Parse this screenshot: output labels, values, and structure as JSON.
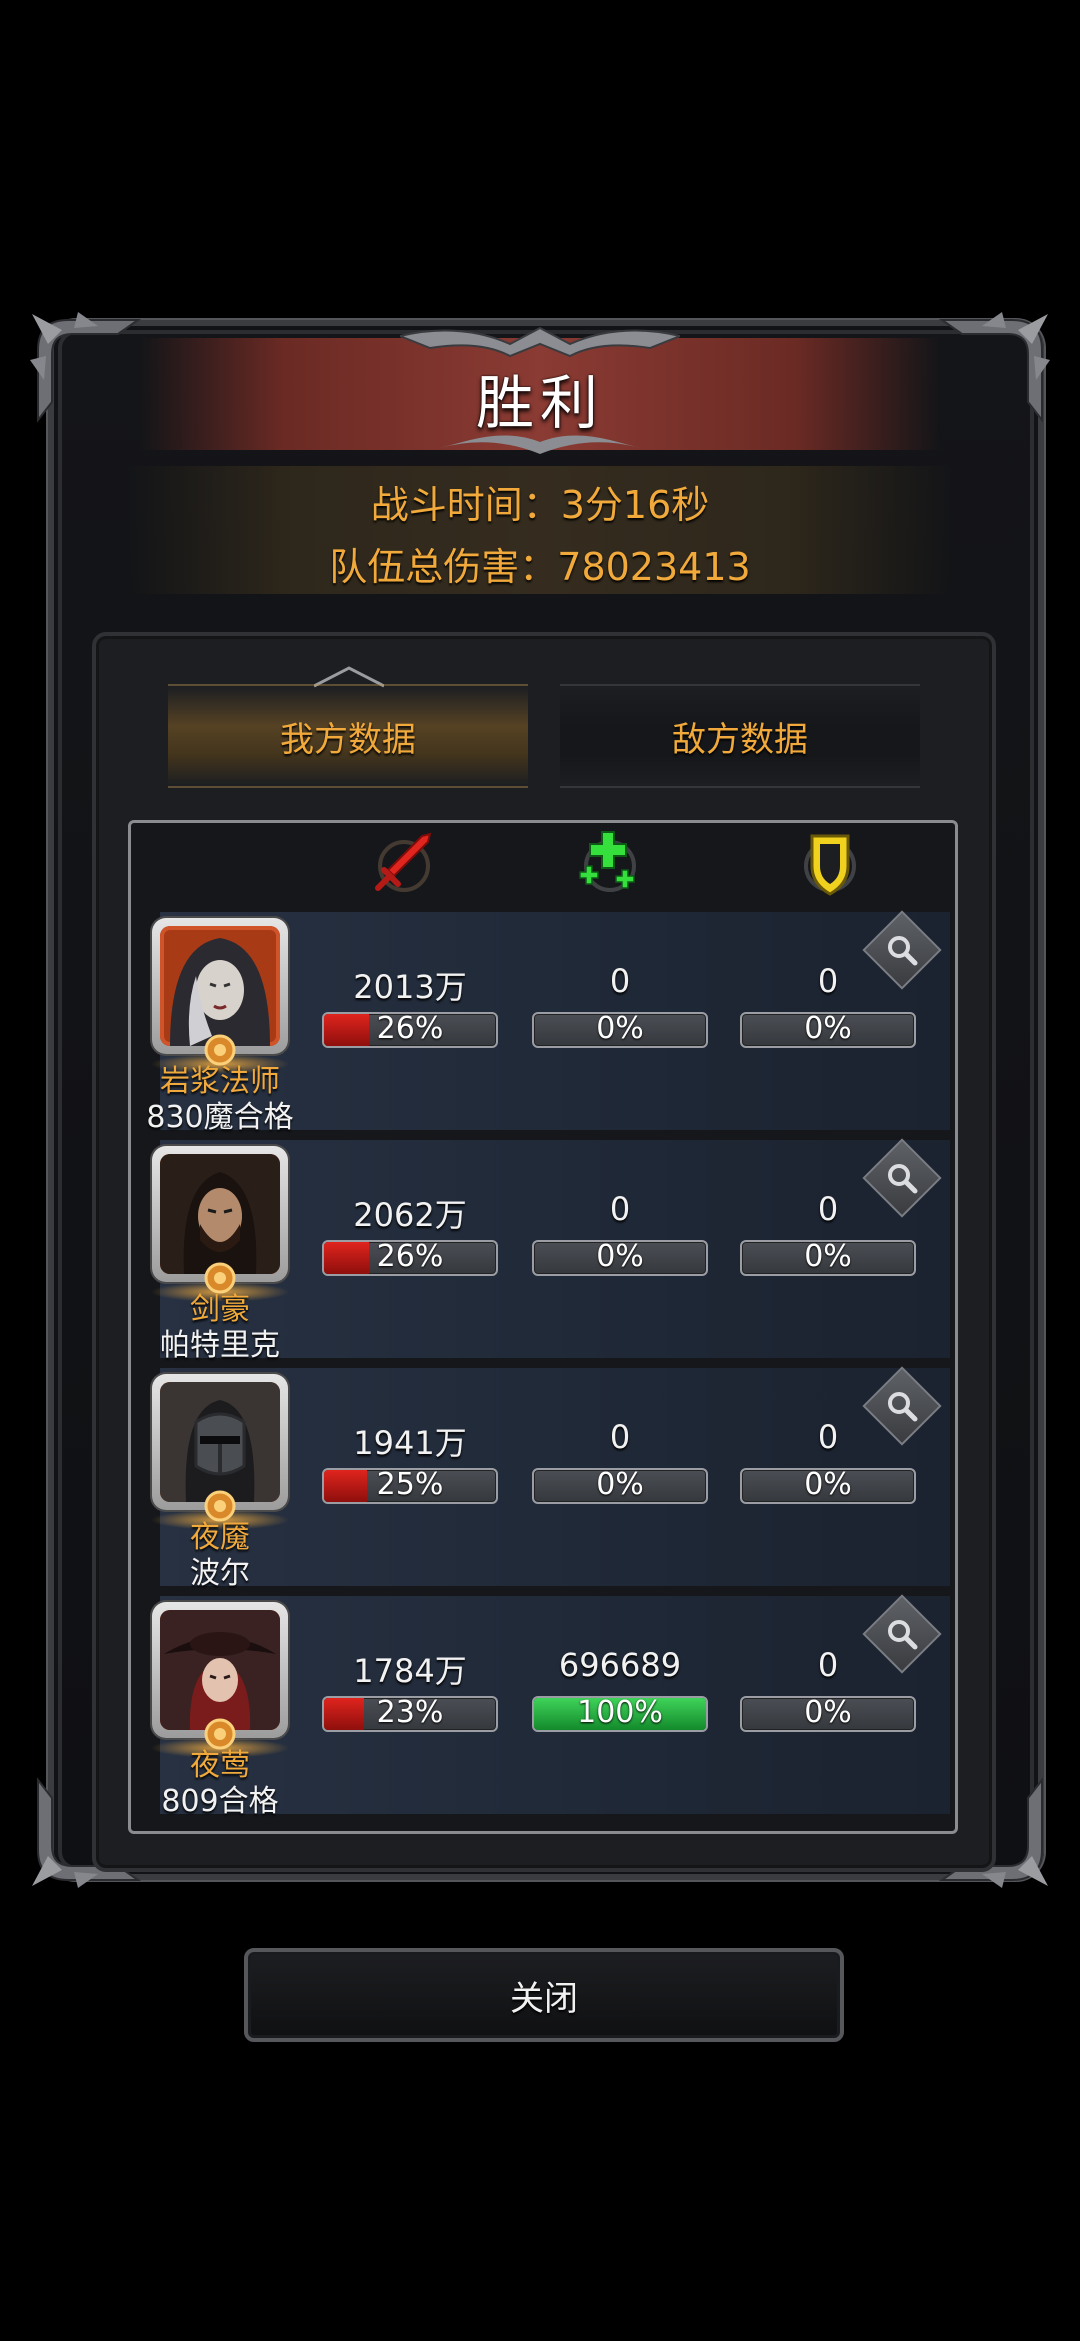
{
  "title": "胜利",
  "battle_info": {
    "time_line": "战斗时间：3分16秒",
    "damage_line": "队伍总伤害：78023413"
  },
  "tabs": [
    {
      "label": "我方数据",
      "active": true
    },
    {
      "label": "敌方数据",
      "active": false
    }
  ],
  "columns": [
    {
      "icon": "sword-damage-icon",
      "color": "#d8231c"
    },
    {
      "icon": "heal-cross-icon",
      "color": "#35e03c"
    },
    {
      "icon": "shield-icon",
      "color": "#f0d21e"
    }
  ],
  "heroes": [
    {
      "class": "岩浆法师",
      "player": "830魔合格",
      "damage": "2013万",
      "damage_pct": "26%",
      "damage_ratio": 0.26,
      "heal": "0",
      "heal_pct": "0%",
      "heal_ratio": 0,
      "tank": "0",
      "tank_pct": "0%",
      "tank_ratio": 0,
      "portrait": "hooded-sorceress"
    },
    {
      "class": "剑豪",
      "player": "帕特里克",
      "damage": "2062万",
      "damage_pct": "26%",
      "damage_ratio": 0.26,
      "heal": "0",
      "heal_pct": "0%",
      "heal_ratio": 0,
      "tank": "0",
      "tank_pct": "0%",
      "tank_ratio": 0,
      "portrait": "bearded-swordsman"
    },
    {
      "class": "夜魇",
      "player": "波尔",
      "damage": "1941万",
      "damage_pct": "25%",
      "damage_ratio": 0.25,
      "heal": "0",
      "heal_pct": "0%",
      "heal_ratio": 0,
      "tank": "0",
      "tank_pct": "0%",
      "tank_ratio": 0,
      "portrait": "masked-knight"
    },
    {
      "class": "夜莺",
      "player": "809合格",
      "damage": "1784万",
      "damage_pct": "23%",
      "damage_ratio": 0.23,
      "heal": "696689",
      "heal_pct": "100%",
      "heal_ratio": 1.0,
      "tank": "0",
      "tank_pct": "0%",
      "tank_ratio": 0,
      "portrait": "red-hat-girl"
    }
  ],
  "close_button": "关闭"
}
